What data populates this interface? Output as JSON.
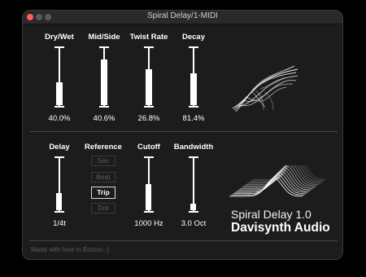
{
  "window": {
    "title": "Spiral Delay/1-MIDI",
    "traffic_lights": [
      "#ff5f57",
      "#5a5a5a",
      "#5a5a5a"
    ]
  },
  "top_sliders": [
    {
      "label": "Dry/Wet",
      "value": "40.0%",
      "level": 0.4
    },
    {
      "label": "Mid/Side",
      "value": "40.6%",
      "level": 0.81
    },
    {
      "label": "Twist Rate",
      "value": "26.8%",
      "level": 0.64
    },
    {
      "label": "Decay",
      "value": "81.4%",
      "level": 0.56
    }
  ],
  "bottom_sliders": [
    {
      "label": "Delay",
      "value": "1/4t",
      "level": 0.33
    },
    {
      "label": "Cutoff",
      "value": "1000 Hz",
      "level": 0.5
    },
    {
      "label": "Bandwidth",
      "value": "3.0 Oct",
      "level": 0.12
    }
  ],
  "reference": {
    "label": "Reference",
    "options": [
      "Sec",
      "Beat",
      "Trip",
      "Dot"
    ],
    "selected": "Trip"
  },
  "brand": {
    "product": "Spiral Delay 1.0",
    "company": "Davisynth Audio"
  },
  "footer": "Made with love in Boston :)",
  "icons": [
    "spiral-visual-icon",
    "wave-visual-icon"
  ]
}
